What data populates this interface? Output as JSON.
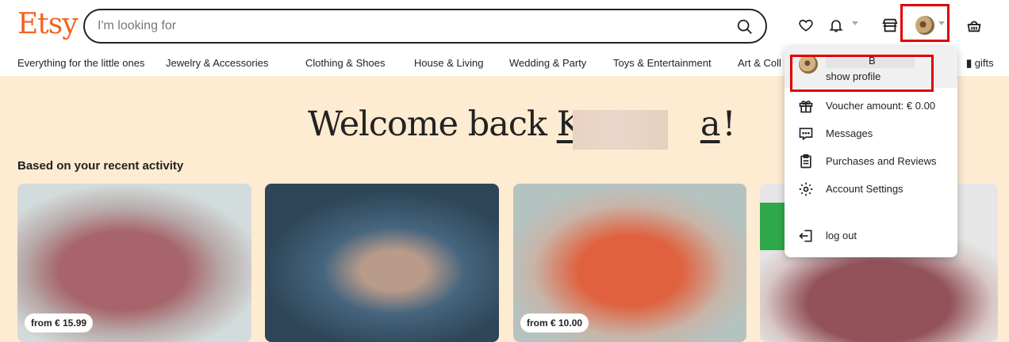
{
  "header": {
    "logo": "Etsy",
    "search_placeholder": "I'm looking for",
    "icons": [
      "search-icon",
      "heart-icon",
      "bell-icon",
      "shop-icon",
      "avatar",
      "basket-icon"
    ]
  },
  "nav": {
    "items": [
      "Everything for the little ones",
      "Jewelry & Accessories",
      "Clothing & Shoes",
      "House & Living",
      "Wedding & Party",
      "Toys & Entertainment",
      "Art & Coll",
      "gifts"
    ]
  },
  "hero": {
    "welcome_prefix": "Welcome back ",
    "name_start": "K",
    "name_end": "a",
    "welcome_suffix": " !",
    "subheading": "Based on your recent activity"
  },
  "products": [
    {
      "price": "from € 15.99"
    },
    {
      "price": ""
    },
    {
      "price": "from € 10.00"
    },
    {
      "price": ""
    }
  ],
  "dropdown": {
    "profile_name": "B",
    "profile_link": "show profile",
    "items": [
      {
        "label": "Voucher amount: € 0.00",
        "icon": "gift-icon"
      },
      {
        "label": "Messages",
        "icon": "message-icon"
      },
      {
        "label": "Purchases and Reviews",
        "icon": "clipboard-icon"
      },
      {
        "label": "Account Settings",
        "icon": "gear-icon"
      },
      {
        "label": "log out",
        "icon": "logout-icon"
      }
    ]
  },
  "colors": {
    "brand": "#F1641E",
    "hero_bg": "#FDEBD2",
    "highlight": "#E00000"
  }
}
